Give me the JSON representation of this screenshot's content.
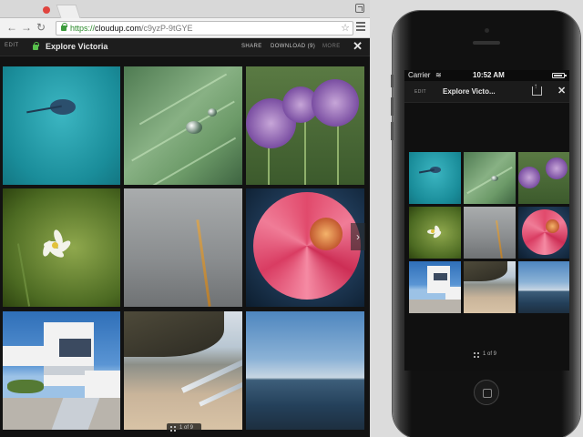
{
  "browser": {
    "url": {
      "scheme": "https://",
      "host": "cloudup.com",
      "path": "/c9yzP-9tGYE"
    }
  },
  "app": {
    "edit_label": "EDIT",
    "title": "Explore Victoria",
    "share_label": "SHARE",
    "download_label": "DOWNLOAD (9)",
    "more_label": "MORE",
    "close_symbol": "✕",
    "pager_text": "1 of 9"
  },
  "photos": [
    {
      "subject": "jellyfish",
      "icon": "jellyfish-photo"
    },
    {
      "subject": "leaf with water drops",
      "icon": "leaf-photo"
    },
    {
      "subject": "purple allium flowers",
      "icon": "allium-photo"
    },
    {
      "subject": "white flower",
      "icon": "white-flower-photo"
    },
    {
      "subject": "grass stalk",
      "icon": "grass-photo"
    },
    {
      "subject": "pink flower",
      "icon": "pink-flower-photo"
    },
    {
      "subject": "white building",
      "icon": "building-photo"
    },
    {
      "subject": "beach",
      "icon": "beach-photo"
    },
    {
      "subject": "sea horizon",
      "icon": "sea-photo"
    }
  ],
  "phone": {
    "carrier": "Carrier",
    "time": "10:52 AM",
    "edit_label": "EDIT",
    "title": "Explore Victo...",
    "close_symbol": "✕",
    "pager_text": "1 of 9"
  },
  "colors": {
    "background": "#121212",
    "accent_lock": "#58c14c",
    "tab_close": "#e0443e"
  }
}
